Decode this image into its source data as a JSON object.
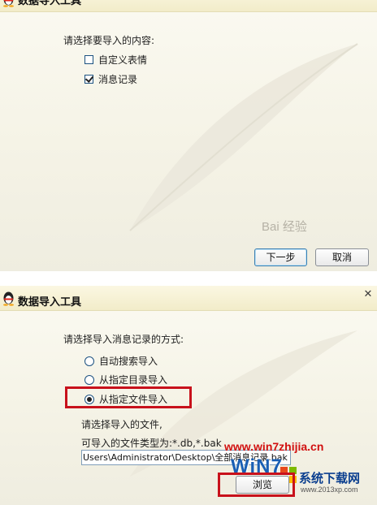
{
  "panel1": {
    "title": "数据导入工具",
    "prompt": "请选择要导入的内容:",
    "options": [
      {
        "label": "自定义表情",
        "checked": false
      },
      {
        "label": "消息记录",
        "checked": true
      }
    ],
    "next_button": "下一步",
    "cancel_button": "取消",
    "watermark": "Bai 经验"
  },
  "panel2": {
    "title": "数据导入工具",
    "close_glyph": "✕",
    "prompt": "请选择导入消息记录的方式:",
    "options": [
      {
        "label": "自动搜索导入",
        "selected": false
      },
      {
        "label": "从指定目录导入",
        "selected": false
      },
      {
        "label": "从指定文件导入",
        "selected": true
      }
    ],
    "file_prompt": "请选择导入的文件,",
    "file_types": "可导入的文件类型为:*.db,*.bak",
    "file_path": "Users\\Administrator\\Desktop\\全部消息记录.bak",
    "browse_button": "浏览",
    "highlight_color": "#c8111b"
  },
  "watermark": {
    "site": "www.win7zhijia.cn",
    "logo": "WiN7",
    "brand": "系统下载网",
    "url": "www.2013xp.com"
  },
  "icons": [
    "qq-penguin-icon",
    "close-icon",
    "feather-decoration"
  ]
}
